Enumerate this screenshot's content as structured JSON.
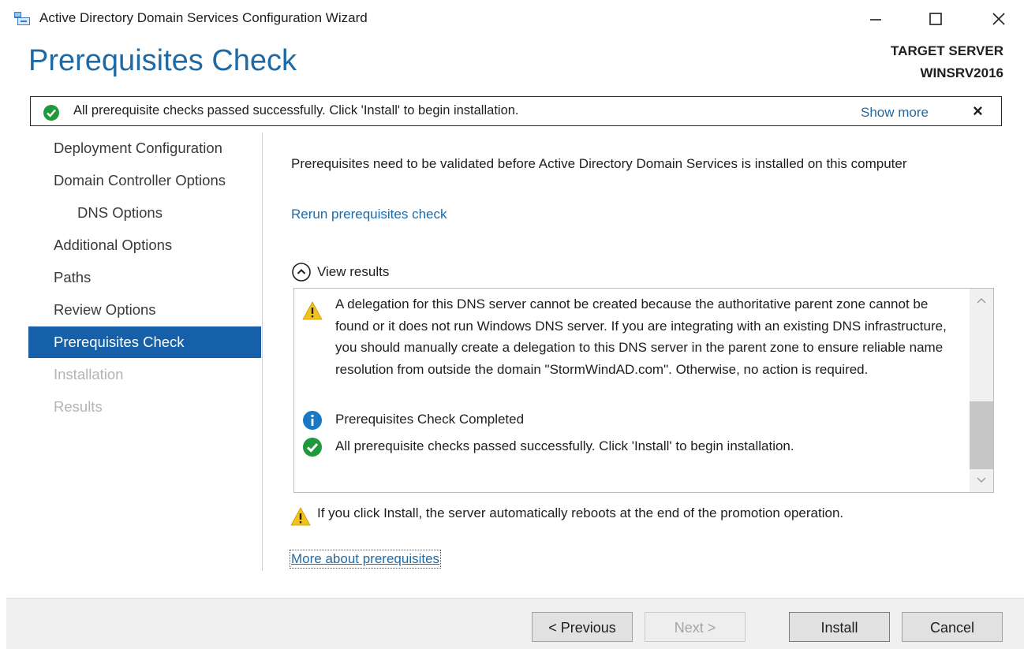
{
  "window": {
    "title": "Active Directory Domain Services Configuration Wizard",
    "controls": {
      "minimize": "–",
      "maximize": "☐",
      "close": "✕"
    }
  },
  "header": {
    "heading": "Prerequisites Check",
    "target_server_label": "TARGET SERVER",
    "target_server_name": "WINSRV2016"
  },
  "banner": {
    "icon": "success-check-icon",
    "text": "All prerequisite checks passed successfully.  Click 'Install' to begin installation.",
    "show_more": "Show more",
    "close": "×"
  },
  "sidebar": {
    "items": [
      {
        "label": "Deployment Configuration",
        "state": "normal"
      },
      {
        "label": "Domain Controller Options",
        "state": "normal"
      },
      {
        "label": "DNS Options",
        "state": "normal",
        "indent": true
      },
      {
        "label": "Additional Options",
        "state": "normal"
      },
      {
        "label": "Paths",
        "state": "normal"
      },
      {
        "label": "Review Options",
        "state": "normal"
      },
      {
        "label": "Prerequisites Check",
        "state": "active"
      },
      {
        "label": "Installation",
        "state": "disabled"
      },
      {
        "label": "Results",
        "state": "disabled"
      }
    ]
  },
  "main": {
    "description": "Prerequisites need to be validated before Active Directory Domain Services is installed on this computer",
    "rerun_link": "Rerun prerequisites check",
    "view_results": "View results",
    "results": [
      {
        "icon": "warning-icon",
        "text": "A delegation for this DNS server cannot be created because the authoritative parent zone cannot be found or it does not run Windows DNS server. If you are integrating with an existing DNS infrastructure, you should manually create a delegation to this DNS server in the parent zone to ensure reliable name resolution from outside the domain \"StormWindAD.com\". Otherwise, no action is required."
      },
      {
        "icon": "info-icon",
        "text": "Prerequisites Check Completed"
      },
      {
        "icon": "success-check-icon",
        "text": "All prerequisite checks passed successfully.  Click 'Install' to begin installation."
      }
    ],
    "reboot_warning": "If you click Install, the server automatically reboots at the end of the promotion operation.",
    "more_link": "More about prerequisites"
  },
  "footer": {
    "previous": "< Previous",
    "next": "Next >",
    "install": "Install",
    "cancel": "Cancel"
  },
  "colors": {
    "accent": "#1f6aa5",
    "active_nav_bg": "#1660a9",
    "success": "#1e9a3c",
    "warning": "#f2c21a",
    "info": "#1a78c2"
  }
}
